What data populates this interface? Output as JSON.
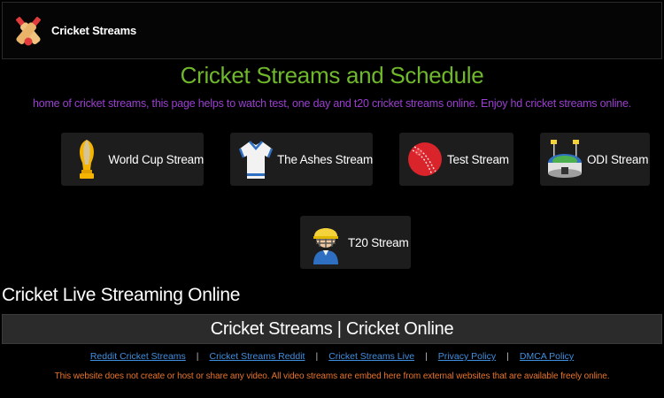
{
  "header": {
    "logo_text": "Cricket Streams"
  },
  "page": {
    "title": "Cricket Streams and Schedule",
    "description": "home of cricket streams, this page helps to watch test, one day and t20 cricket streams online. Enjoy hd cricket streams online."
  },
  "cards": [
    {
      "label": "World Cup Stream",
      "icon": "trophy-icon"
    },
    {
      "label": "The Ashes Stream",
      "icon": "jersey-icon"
    },
    {
      "label": "Test Stream",
      "icon": "cricket-ball-icon"
    },
    {
      "label": "ODI Stream",
      "icon": "stadium-icon"
    },
    {
      "label": "T20 Stream",
      "icon": "player-helmet-icon"
    }
  ],
  "section": {
    "title": "Cricket Live Streaming Online"
  },
  "banner": {
    "text": "Cricket Streams | Cricket Online"
  },
  "footer": {
    "links": [
      "Reddit Cricket Streams",
      "Cricket Streams Reddit",
      "Cricket Streams Live",
      "Privacy Policy",
      "DMCA Policy"
    ],
    "separator": "|",
    "disclaimer": "This website does not create or host or share any video. All video streams are embed here from external websites that are available freely online."
  },
  "colors": {
    "title_green": "#6fb82c",
    "desc_purple": "#9b3fd0",
    "link_blue": "#3f8fe0",
    "disclaimer_orange": "#e8742a",
    "card_bg": "#1d1d1d"
  }
}
